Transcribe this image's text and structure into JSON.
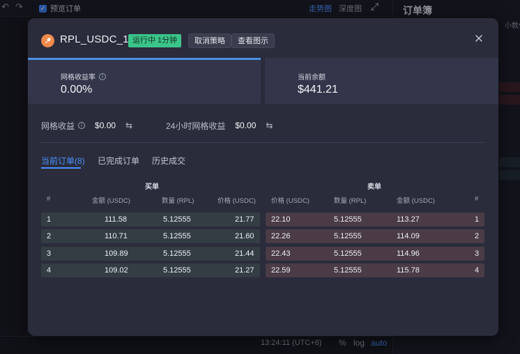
{
  "background": {
    "preview_label": "预览订单",
    "tab_trend": "走势图",
    "tab_depth": "深度图",
    "orderbook_title": "订单簿",
    "decimal_label": "小数位",
    "time_display": "13:24:11 (UTC+8)",
    "scale_percent": "%",
    "scale_log": "log",
    "scale_auto": "auto"
  },
  "modal": {
    "pair": "RPL_USDC_1",
    "status": "运行中 1分钟",
    "cancel_button": "取消策略",
    "view_chart_button": "查看图示",
    "grid_yield_label": "网格收益率",
    "grid_yield_value": "0.00%",
    "balance_label": "当前余额",
    "balance_value": "$441.21",
    "grid_profit_label": "网格收益",
    "grid_profit_value": "$0.00",
    "profit_24h_label": "24小时网格收益",
    "profit_24h_value": "$0.00",
    "tabs": [
      {
        "label": "当前订单(8)",
        "active": true
      },
      {
        "label": "已完成订单",
        "active": false
      },
      {
        "label": "历史成交",
        "active": false
      }
    ],
    "buy_title": "买单",
    "sell_title": "卖单",
    "buy_headers": {
      "index": "#",
      "amount": "金额 (USDC)",
      "qty": "数量 (RPL)",
      "price": "价格 (USDC)"
    },
    "sell_headers": {
      "price": "价格 (USDC)",
      "qty": "数量 (RPL)",
      "amount": "金额 (USDC)",
      "index": "#"
    },
    "buy_orders": [
      {
        "index": "1",
        "amount": "111.58",
        "qty": "5.12555",
        "price": "21.77"
      },
      {
        "index": "2",
        "amount": "110.71",
        "qty": "5.12555",
        "price": "21.60"
      },
      {
        "index": "3",
        "amount": "109.89",
        "qty": "5.12555",
        "price": "21.44"
      },
      {
        "index": "4",
        "amount": "109.02",
        "qty": "5.12555",
        "price": "21.27"
      }
    ],
    "sell_orders": [
      {
        "price": "22.10",
        "qty": "5.12555",
        "amount": "113.27",
        "index": "1"
      },
      {
        "price": "22.26",
        "qty": "5.12555",
        "amount": "114.09",
        "index": "2"
      },
      {
        "price": "22.43",
        "qty": "5.12555",
        "amount": "114.96",
        "index": "3"
      },
      {
        "price": "22.59",
        "qty": "5.12555",
        "amount": "115.78",
        "index": "4"
      }
    ],
    "colors": {
      "accent": "#4a90ff",
      "status_badge": "#3bc48a",
      "buy_row": "#343d44",
      "sell_row": "#4a3b46",
      "coin": "#f08a4b"
    }
  }
}
